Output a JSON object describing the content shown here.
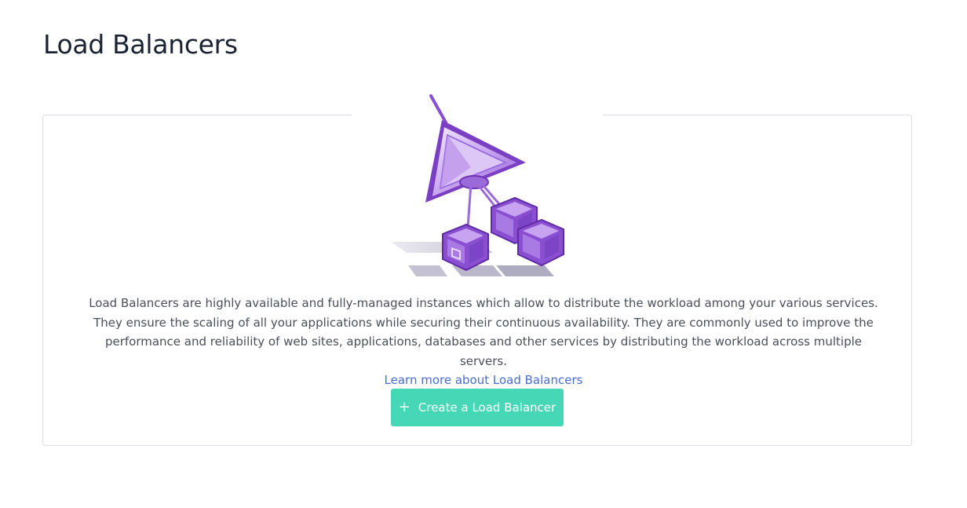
{
  "header": {
    "title": "Load Balancers"
  },
  "empty_state": {
    "illustration": "load-balancer-prism-cubes-illustration",
    "description_lines": [
      "Load Balancers are highly available and fully-managed instances which allow to distribute the workload among your various services.",
      "They ensure the scaling of all your applications while securing their continuous availability. They are commonly used to improve the",
      "performance and reliability of web sites, applications, databases and other services by distributing the workload across multiple servers."
    ],
    "learn_more_label": "Learn more about Load Balancers",
    "create_button": {
      "icon": "plus-icon",
      "label": "Create a Load Balancer"
    }
  },
  "colors": {
    "accent_button": "#46d8b6",
    "link": "#4a6ed1",
    "illustration_purple": "#8a4fd1",
    "title": "#1b2333"
  }
}
